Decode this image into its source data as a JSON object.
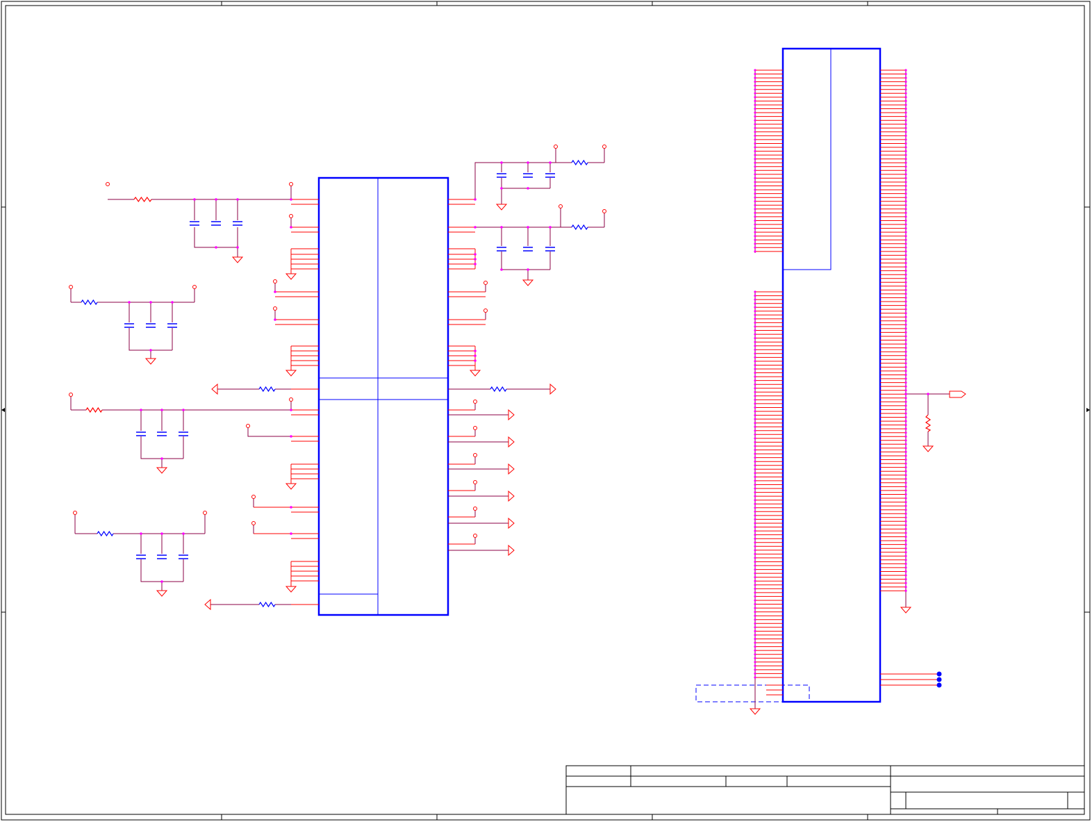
{
  "sheet": {
    "colors": {
      "border": "#000000",
      "wire": "#8b0046",
      "pin": "#ff0000",
      "junction": "#ff00ff",
      "body": "#0000ff",
      "net_dot": "#0000ff"
    }
  },
  "title_block": {
    "cells": [
      "",
      "",
      "",
      "",
      "",
      "",
      "",
      "",
      "",
      ""
    ]
  }
}
